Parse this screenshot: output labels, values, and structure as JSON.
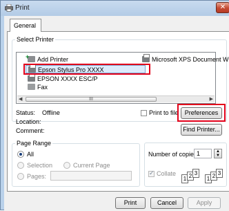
{
  "window": {
    "title": "Print",
    "close_label": "✕"
  },
  "tabs": [
    {
      "label": "General"
    }
  ],
  "select_printer": {
    "legend": "Select Printer",
    "items": [
      {
        "label": "Add Printer",
        "icon": "add-printer-icon"
      },
      {
        "label": "Microsoft XPS Document Writer",
        "icon": "printer-icon"
      },
      {
        "label": "Epson Stylus Pro XXXX",
        "icon": "printer-icon",
        "selected": true
      },
      {
        "label": "EPSON XXXX ESC/P",
        "icon": "printer-icon"
      },
      {
        "label": "Fax",
        "icon": "fax-icon"
      }
    ],
    "scroll_thumb_label": "III",
    "status_label": "Status:",
    "status_value": "Offline",
    "location_label": "Location:",
    "location_value": "",
    "comment_label": "Comment:",
    "comment_value": "",
    "print_to_file_label": "Print to file",
    "preferences_label": "Preferences",
    "find_printer_label": "Find Printer..."
  },
  "page_range": {
    "legend": "Page Range",
    "all_label": "All",
    "selection_label": "Selection",
    "current_page_label": "Current Page",
    "pages_label": "Pages:",
    "pages_value": ""
  },
  "copies": {
    "number_label": "Number of copies:",
    "number_value": "1",
    "collate_label": "Collate",
    "collate_checked": true
  },
  "footer": {
    "print_label": "Print",
    "cancel_label": "Cancel",
    "apply_label": "Apply"
  },
  "colors": {
    "frame": "#b9d1ea",
    "highlight_box": "#e2001a",
    "selection": "#dcebfc"
  }
}
